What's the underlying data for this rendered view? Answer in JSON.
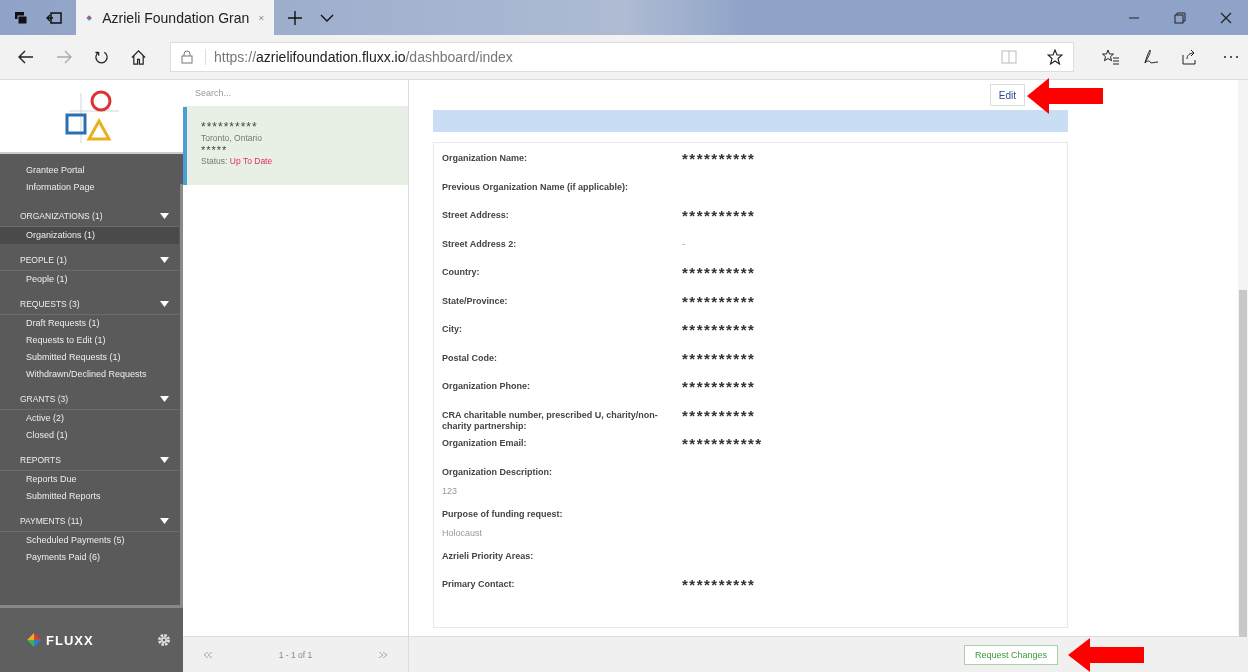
{
  "browser": {
    "tab_title": "Azrieli Foundation Gran",
    "url_prefix": "https://",
    "url_host": "azrielifoundation.fluxx.io",
    "url_path": "/dashboard/index"
  },
  "sidebar": {
    "links": [
      {
        "label": "Grantee Portal"
      },
      {
        "label": "Information Page"
      }
    ],
    "sections": [
      {
        "title": "ORGANIZATIONS (1)",
        "expanded": true,
        "items": [
          {
            "label": "Organizations  (1)",
            "selected": true
          }
        ]
      },
      {
        "title": "PEOPLE (1)",
        "expanded": true,
        "items": [
          {
            "label": "People  (1)",
            "selected": false
          }
        ]
      },
      {
        "title": "REQUESTS (3)",
        "expanded": true,
        "items": [
          {
            "label": "Draft Requests  (1)",
            "selected": false
          },
          {
            "label": "Requests to Edit  (1)",
            "selected": false
          },
          {
            "label": "Submitted Requests  (1)",
            "selected": false
          },
          {
            "label": "Withdrawn/Declined Requests",
            "selected": false
          }
        ]
      },
      {
        "title": "GRANTS (3)",
        "expanded": true,
        "items": [
          {
            "label": "Active  (2)",
            "selected": false
          },
          {
            "label": "Closed  (1)",
            "selected": false
          }
        ]
      },
      {
        "title": "REPORTS",
        "expanded": true,
        "items": [
          {
            "label": "Reports Due",
            "selected": false
          },
          {
            "label": "Submitted Reports",
            "selected": false
          }
        ]
      },
      {
        "title": "PAYMENTS (11)",
        "expanded": true,
        "items": [
          {
            "label": "Scheduled Payments  (5)",
            "selected": false
          },
          {
            "label": "Payments Paid  (6)",
            "selected": false
          }
        ]
      }
    ],
    "brand": "FLUXX"
  },
  "list": {
    "search": {
      "placeholder": "Search..."
    },
    "cards": [
      {
        "name": "**********",
        "location": "Toronto, Ontario",
        "line_3": "*****",
        "status_label": "Status:",
        "status": "Up To Date",
        "selected": true
      }
    ],
    "pagination": "1 - 1 of 1"
  },
  "detail": {
    "edit_button": "Edit",
    "fields": [
      {
        "label": "Organization Name:",
        "value": "**********",
        "kind": "inline"
      },
      {
        "label": "Previous Organization Name (if applicable):",
        "kind": "inline"
      },
      {
        "label": "Street Address:",
        "value": "**********",
        "kind": "inline"
      },
      {
        "label": "Street Address 2:",
        "value": "-",
        "kind": "inline"
      },
      {
        "label": "Country:",
        "value": "**********",
        "kind": "inline"
      },
      {
        "label": "State/Province:",
        "value": "**********",
        "kind": "inline"
      },
      {
        "label": "City:",
        "value": "**********",
        "kind": "inline"
      },
      {
        "label": "Postal Code:",
        "value": "**********",
        "kind": "inline"
      },
      {
        "label": "Organization Phone:",
        "value": "**********",
        "kind": "inline"
      },
      {
        "label": "CRA charitable number, prescribed U, charity/non-charity partnership:",
        "value": "**********",
        "kind": "inline"
      },
      {
        "label": "Organization Email:",
        "value": "***********",
        "kind": "inline"
      },
      {
        "label": "Organization Description:",
        "value": "123",
        "kind": "stacked"
      },
      {
        "label": "Purpose of funding request:",
        "value": "Holocaust",
        "kind": "stacked"
      },
      {
        "label": "Azrieli Priority Areas:",
        "kind": "inline"
      },
      {
        "label": "Primary Contact:",
        "value": "**********",
        "kind": "inline"
      }
    ],
    "request_button": "Request Changes"
  }
}
